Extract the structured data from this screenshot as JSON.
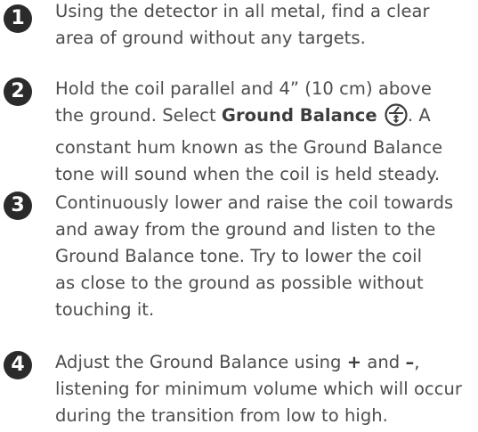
{
  "steps": [
    {
      "number": "1",
      "lines": [
        "Using the detector in all metal, find a clear",
        "area of ground without any targets."
      ]
    },
    {
      "number": "2",
      "line1": "Hold the coil parallel and 4” (10 cm) above",
      "line2_prefix": "the ground. Select ",
      "line2_bold": "Ground Balance",
      "line2_suffix": ". A",
      "icon": "ground-balance-icon",
      "lines_rest": [
        "constant hum known as the Ground Balance",
        "tone will sound when the coil is held steady."
      ]
    },
    {
      "number": "3",
      "lines": [
        "Continuously lower and raise the coil towards",
        "and away from the ground and listen to the",
        "Ground Balance tone. Try to lower the coil",
        "as close to the ground as possible without",
        "touching it."
      ]
    },
    {
      "number": "4",
      "line1_prefix": "Adjust the Ground Balance using ",
      "plus": "+",
      "and": " and ",
      "minus": "–",
      "comma": ",",
      "lines_rest": [
        "listening for minimum volume which will occur",
        "during the transition from low to high."
      ]
    }
  ]
}
